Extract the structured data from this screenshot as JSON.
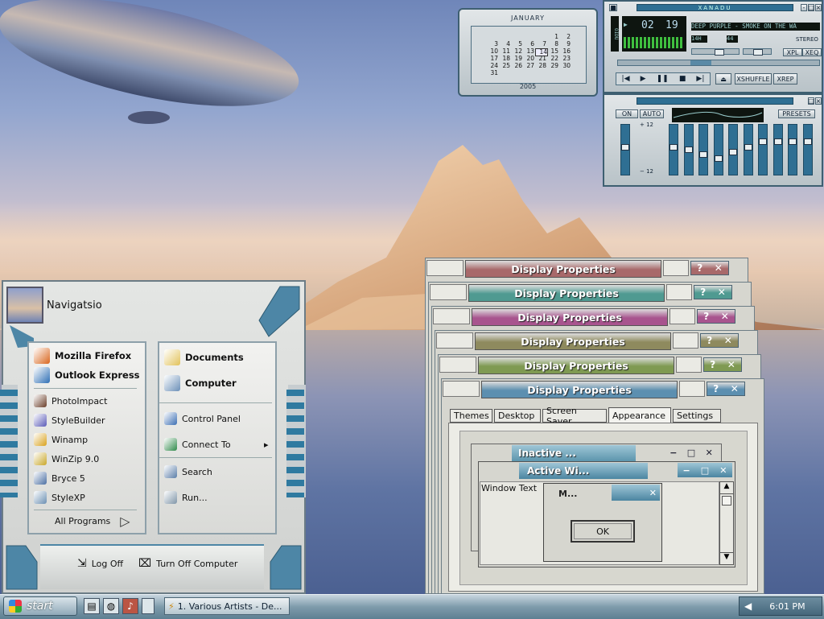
{
  "desktop": {
    "taskbar": {
      "start_label": "start",
      "task_label": "1. Various Artists - De...",
      "clock": "6:01 PM"
    }
  },
  "calendar": {
    "month": "JANUARY",
    "year": "2005",
    "rows": [
      [
        "",
        "",
        "",
        "",
        "",
        "1",
        "2"
      ],
      [
        "3",
        "4",
        "5",
        "6",
        "7",
        "8",
        "9"
      ],
      [
        "10",
        "11",
        "12",
        "13",
        "14",
        "15",
        "16"
      ],
      [
        "17",
        "18",
        "19",
        "20",
        "21",
        "22",
        "23"
      ],
      [
        "24",
        "25",
        "26",
        "27",
        "28",
        "29",
        "30"
      ],
      [
        "31",
        "",
        "",
        "",
        "",
        "",
        ""
      ]
    ],
    "today": "14"
  },
  "winamp": {
    "title": "XANADU",
    "time_min": "02",
    "time_sec": "19",
    "song": "DEEP PURPLE - SMOKE ON THE WA",
    "kbps": "14H",
    "khz": "44",
    "stereo": "STEREO",
    "xpl": "XPL",
    "xeq": "XEQ",
    "shuffle": "XSHUFFLE",
    "repeat": "XREP",
    "side_label": "OIDU",
    "eq_on": "ON",
    "eq_auto": "AUTO",
    "eq_presets": "PRESETS",
    "eq_plus": "+ 12",
    "eq_minus": "− 12",
    "eq_preamp": 0.45,
    "eq_bands": [
      0.45,
      0.5,
      0.62,
      0.7,
      0.55,
      0.45,
      0.32,
      0.32,
      0.32,
      0.32
    ]
  },
  "start_menu": {
    "user": "Navigatsio",
    "pinned": [
      {
        "label": "Mozilla Firefox",
        "icon": "firefox-icon",
        "color": "#d9661e"
      },
      {
        "label": "Outlook Express",
        "icon": "outlook-icon",
        "color": "#2e6fb5"
      }
    ],
    "recent": [
      {
        "label": "PhotoImpact",
        "icon": "photoimpact-icon",
        "color": "#6b3f2a"
      },
      {
        "label": "StyleBuilder",
        "icon": "stylebuilder-icon",
        "color": "#5b5bb8"
      },
      {
        "label": "Winamp",
        "icon": "winamp-icon",
        "color": "#d9a21e"
      },
      {
        "label": "WinZip 9.0",
        "icon": "winzip-icon",
        "color": "#c9a72a"
      },
      {
        "label": "Bryce 5",
        "icon": "bryce-icon",
        "color": "#4b6fa3"
      },
      {
        "label": "StyleXP",
        "icon": "stylexp-icon",
        "color": "#6b8fb3"
      }
    ],
    "all_programs": "All Programs",
    "places_bold": [
      {
        "label": "Documents",
        "icon": "documents-folder-icon",
        "color": "#e2c25a"
      },
      {
        "label": "Computer",
        "icon": "computer-icon",
        "color": "#6b8fb8"
      }
    ],
    "places": [
      {
        "label": "Control Panel",
        "icon": "control-panel-icon",
        "color": "#3b6eb3"
      },
      {
        "label": "Connect To",
        "icon": "connect-globe-icon",
        "color": "#2f8a4a"
      }
    ],
    "tools": [
      {
        "label": "Search",
        "icon": "search-icon",
        "color": "#5a7ea8"
      },
      {
        "label": "Run...",
        "icon": "run-icon",
        "color": "#7f95a8"
      }
    ],
    "log_off": "Log Off",
    "turn_off": "Turn Off Computer"
  },
  "display_props": {
    "windows": [
      {
        "title": "Display Properties",
        "color": "#a8696a"
      },
      {
        "title": "Display Properties",
        "color": "#4f9a91"
      },
      {
        "title": "Display Properties",
        "color": "#a8548e"
      },
      {
        "title": "Display Properties",
        "color": "#8e8a5e"
      },
      {
        "title": "Display Properties",
        "color": "#7f9a52"
      },
      {
        "title": "Display Properties",
        "color": "#5c8fb0"
      }
    ],
    "tabs": [
      "Themes",
      "Desktop",
      "Screen Saver",
      "Appearance",
      "Settings"
    ],
    "selected_tab": "Appearance",
    "preview": {
      "inactive_title": "Inactive ...",
      "active_title": "Active Wi...",
      "window_text": "Window Text",
      "msgbox_title": "M...",
      "ok_label": "OK"
    }
  }
}
